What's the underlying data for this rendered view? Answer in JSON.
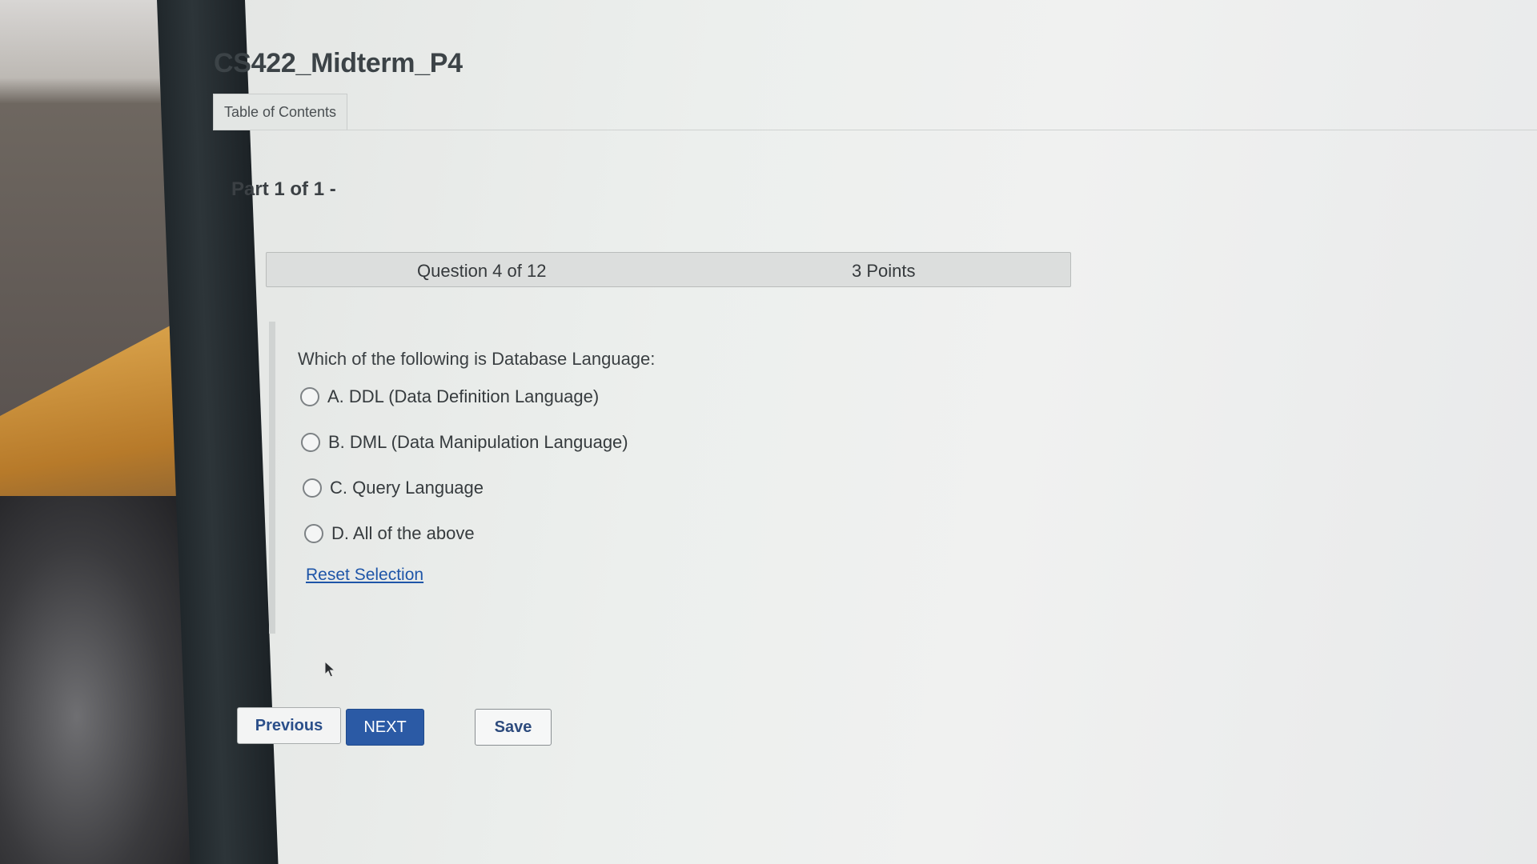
{
  "exam": {
    "title": "CS422_Midterm_P4",
    "toc_tab_label": "Table of Contents",
    "part_label": "Part 1 of 1 -"
  },
  "question": {
    "number_label": "Question 4 of 12",
    "points_label": "3 Points",
    "text": "Which of the following is Database Language:",
    "options": [
      {
        "label": "A. DDL (Data Definition Language)",
        "selected": false
      },
      {
        "label": "B. DML (Data Manipulation Language)",
        "selected": false
      },
      {
        "label": "C. Query Language",
        "selected": false
      },
      {
        "label": "D. All of the above",
        "selected": false
      }
    ],
    "reset_label": "Reset Selection"
  },
  "navigation": {
    "previous_label": "Previous",
    "next_label": "NEXT",
    "save_label": "Save"
  },
  "colors": {
    "accent": "#2b5aa5",
    "link": "#1e55a8",
    "title": "#3c4347"
  }
}
